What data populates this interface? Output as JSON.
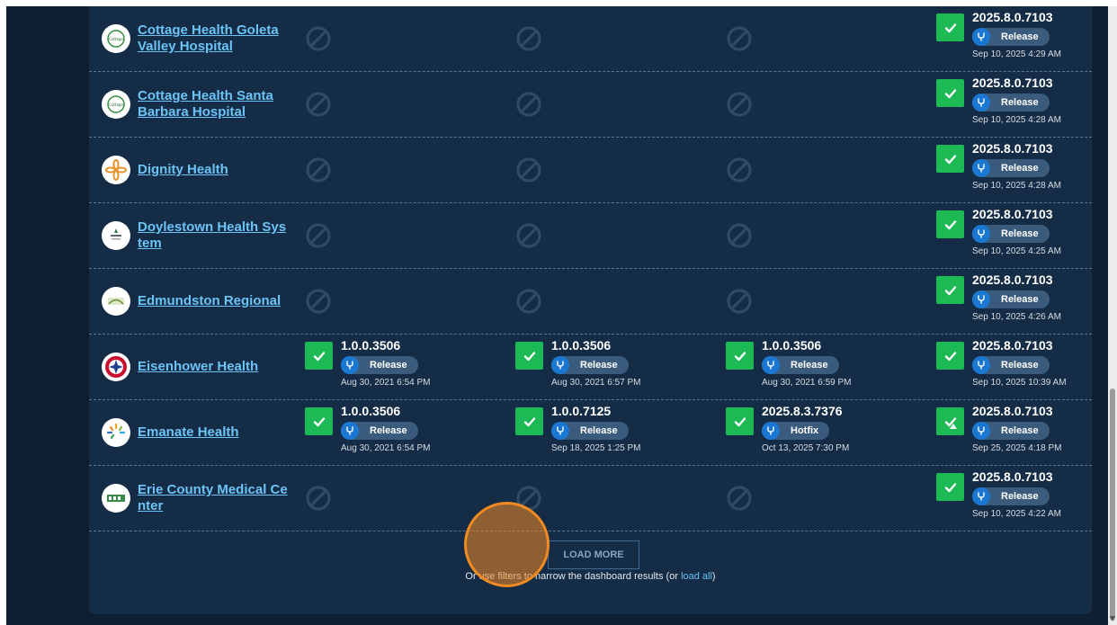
{
  "rows": [
    {
      "name": "Cottage Health Goleta Valley Hospital",
      "logo": "cottage-health-logo",
      "cells": [
        {
          "status": "none"
        },
        {
          "status": "none"
        },
        {
          "status": "none"
        },
        {
          "status": "ok",
          "version": "2025.8.0.7103",
          "channel": "Release",
          "date": "Sep 10, 2025 4:29 AM"
        }
      ]
    },
    {
      "name": "Cottage Health Santa Barbara Hospital",
      "logo": "cottage-health-logo",
      "cells": [
        {
          "status": "none"
        },
        {
          "status": "none"
        },
        {
          "status": "none"
        },
        {
          "status": "ok",
          "version": "2025.8.0.7103",
          "channel": "Release",
          "date": "Sep 10, 2025 4:28 AM"
        }
      ]
    },
    {
      "name": "Dignity Health",
      "logo": "dignity-health-logo",
      "cells": [
        {
          "status": "none"
        },
        {
          "status": "none"
        },
        {
          "status": "none"
        },
        {
          "status": "ok",
          "version": "2025.8.0.7103",
          "channel": "Release",
          "date": "Sep 10, 2025 4:28 AM"
        }
      ]
    },
    {
      "name": "Doylestown Health Sys tem",
      "logo": "doylestown-health-logo",
      "cells": [
        {
          "status": "none"
        },
        {
          "status": "none"
        },
        {
          "status": "none"
        },
        {
          "status": "ok",
          "version": "2025.8.0.7103",
          "channel": "Release",
          "date": "Sep 10, 2025 4:25 AM"
        }
      ]
    },
    {
      "name": "Edmundston Regional",
      "logo": "edmundston-logo",
      "cells": [
        {
          "status": "none"
        },
        {
          "status": "none"
        },
        {
          "status": "none"
        },
        {
          "status": "ok",
          "version": "2025.8.0.7103",
          "channel": "Release",
          "date": "Sep 10, 2025 4:26 AM"
        }
      ]
    },
    {
      "name": "Eisenhower Health",
      "logo": "eisenhower-health-logo",
      "cells": [
        {
          "status": "ok",
          "version": "1.0.0.3506",
          "channel": "Release",
          "date": "Aug 30, 2021 6:54 PM"
        },
        {
          "status": "ok",
          "version": "1.0.0.3506",
          "channel": "Release",
          "date": "Aug 30, 2021 6:57 PM"
        },
        {
          "status": "ok",
          "version": "1.0.0.3506",
          "channel": "Release",
          "date": "Aug 30, 2021 6:59 PM"
        },
        {
          "status": "ok",
          "version": "2025.8.0.7103",
          "channel": "Release",
          "date": "Sep 10, 2025 10:39 AM"
        }
      ]
    },
    {
      "name": "Emanate Health",
      "logo": "emanate-health-logo",
      "cells": [
        {
          "status": "ok",
          "version": "1.0.0.3506",
          "channel": "Release",
          "date": "Aug 30, 2021 6:54 PM"
        },
        {
          "status": "ok",
          "version": "1.0.0.7125",
          "channel": "Release",
          "date": "Sep 18, 2025 1:25 PM"
        },
        {
          "status": "ok",
          "version": "2025.8.3.7376",
          "channel": "Hotfix",
          "date": "Oct 13, 2025 7:30 PM"
        },
        {
          "status": "ok-warning",
          "version": "2025.8.0.7103",
          "channel": "Release",
          "date": "Sep 25, 2025 4:18 PM"
        }
      ]
    },
    {
      "name": "Erie County Medical Ce nter",
      "logo": "ecmc-logo",
      "cells": [
        {
          "status": "none"
        },
        {
          "status": "none"
        },
        {
          "status": "none"
        },
        {
          "status": "ok",
          "version": "2025.8.0.7103",
          "channel": "Release",
          "date": "Sep 10, 2025 4:22 AM"
        }
      ]
    }
  ],
  "load_more_label": "LOAD MORE",
  "footer": {
    "prefix": "Or use filters to narrow the dashboard results (or ",
    "link": "load all",
    "suffix": ")"
  },
  "colors": {
    "background": "#0d1f30",
    "panel": "#142c45",
    "org_link": "#6cc3f5",
    "success": "#1db954",
    "badge": "#3a5b7c",
    "badge_icon": "#1a78d2",
    "cursor": "#f28a22"
  }
}
